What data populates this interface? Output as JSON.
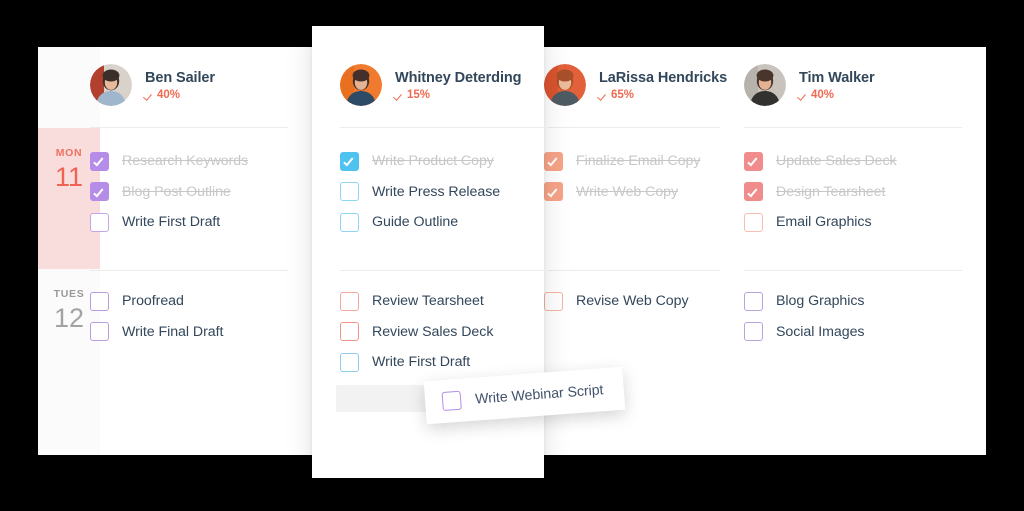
{
  "dates": [
    {
      "dow": "MON",
      "day": "11",
      "active": true
    },
    {
      "dow": "TUES",
      "day": "12",
      "active": false
    }
  ],
  "columns": [
    {
      "name": "Ben Sailer",
      "progress": "40%",
      "avatar_name": "avatar-ben-sailer",
      "rows": [
        [
          {
            "label": "Research Keywords",
            "done": true,
            "color": "#b58ce8"
          },
          {
            "label": "Blog Post Outline",
            "done": true,
            "color": "#b58ce8"
          },
          {
            "label": "Write First Draft",
            "done": false,
            "color": "#c3a6e8"
          }
        ],
        [
          {
            "label": "Proofread",
            "done": false,
            "color": "#b89ce0"
          },
          {
            "label": "Write Final Draft",
            "done": false,
            "color": "#b89ce0"
          }
        ]
      ]
    },
    {
      "name": "Whitney Deterding",
      "progress": "15%",
      "avatar_name": "avatar-whitney-deterding",
      "rows": [
        [
          {
            "label": "Write Product Copy",
            "done": true,
            "color": "#4ec3ef"
          },
          {
            "label": "Write Press Release",
            "done": false,
            "color": "#8fd4f2"
          },
          {
            "label": "Guide Outline",
            "done": false,
            "color": "#8fd4f2"
          }
        ],
        [
          {
            "label": "Review Tearsheet",
            "done": false,
            "color": "#f5a79b"
          },
          {
            "label": "Review Sales Deck",
            "done": false,
            "color": "#f2958a"
          },
          {
            "label": "Write First Draft",
            "done": false,
            "color": "#8ecdf0"
          }
        ]
      ]
    },
    {
      "name": "LaRissa Hendricks",
      "progress": "65%",
      "avatar_name": "avatar-larissa-hendricks",
      "rows": [
        [
          {
            "label": "Finalize Email Copy",
            "done": true,
            "color": "#f7a488"
          },
          {
            "label": "Write Web Copy",
            "done": true,
            "color": "#f7a488"
          }
        ],
        [
          {
            "label": "Revise Web Copy",
            "done": false,
            "color": "#f6b3a4"
          }
        ]
      ]
    },
    {
      "name": "Tim Walker",
      "progress": "40%",
      "avatar_name": "avatar-tim-walker",
      "rows": [
        [
          {
            "label": "Update Sales Deck",
            "done": true,
            "color": "#f08c8c"
          },
          {
            "label": "Design Tearsheet",
            "done": true,
            "color": "#f08c8c"
          },
          {
            "label": "Email Graphics",
            "done": false,
            "color": "#f6bfb0"
          }
        ],
        [
          {
            "label": "Blog Graphics",
            "done": false,
            "color": "#bba2e0"
          },
          {
            "label": "Social Images",
            "done": false,
            "color": "#bba2e0"
          }
        ]
      ]
    }
  ],
  "dragged_card": {
    "label": "Write Webinar Script",
    "color": "#b58ce8"
  },
  "theme": {
    "accent": "#ef6a52",
    "active_day_bg": "#f9dcdc",
    "text": "#33475b",
    "done_text": "#c7c7c7",
    "divider": "#ececec",
    "dropzone": "#f2f2f2"
  }
}
